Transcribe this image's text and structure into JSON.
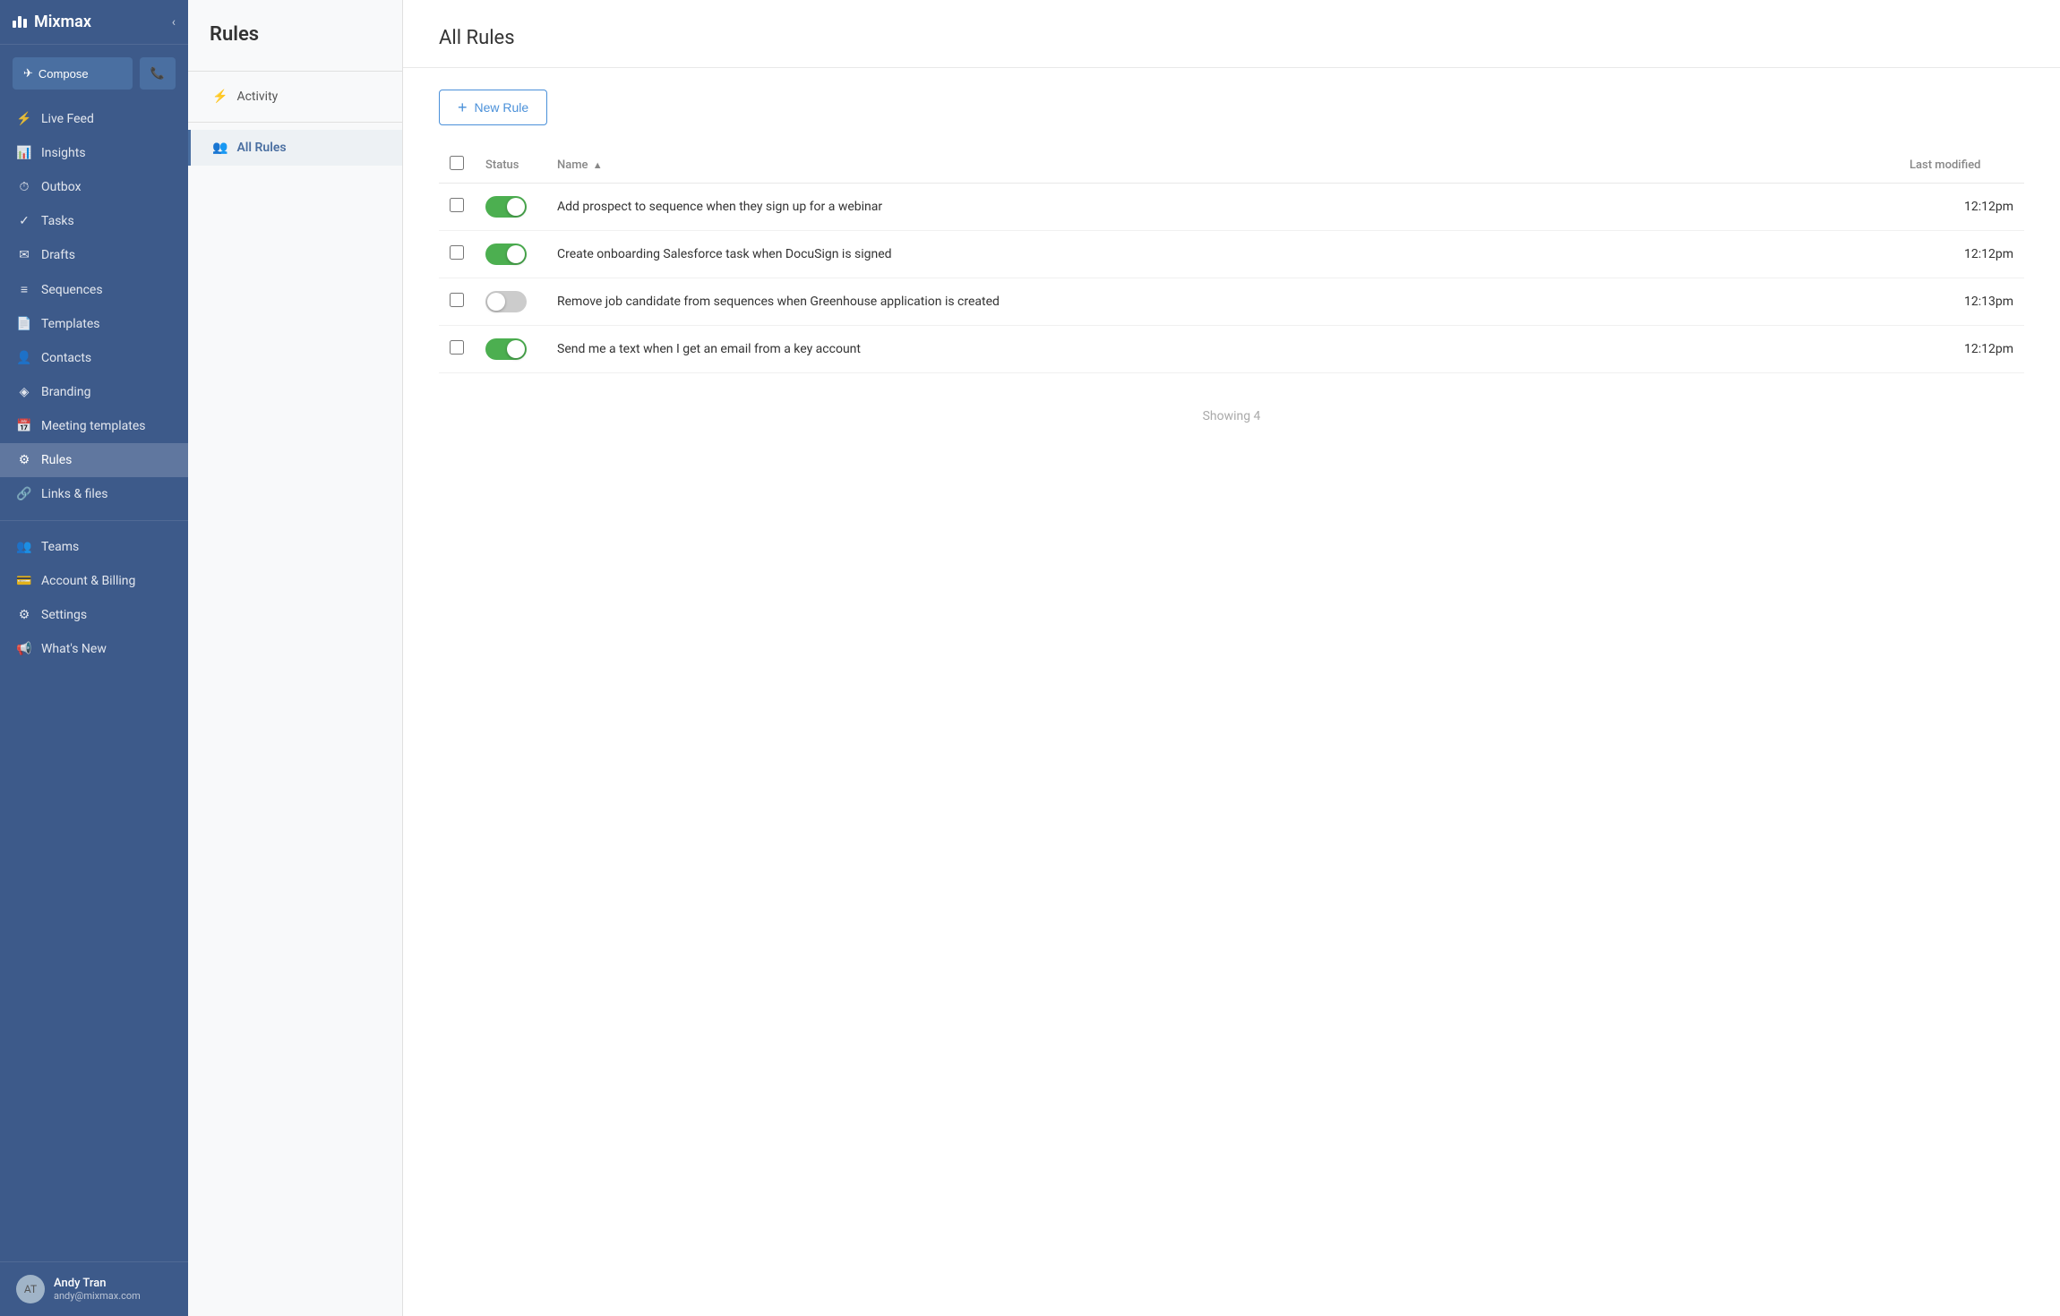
{
  "app": {
    "name": "Mixmax"
  },
  "sidebar": {
    "collapse_label": "‹",
    "compose_label": "Compose",
    "phone_label": "☎",
    "nav_items": [
      {
        "id": "live-feed",
        "label": "Live Feed",
        "icon": "⚡",
        "active": false
      },
      {
        "id": "insights",
        "label": "Insights",
        "icon": "📊",
        "active": false
      },
      {
        "id": "outbox",
        "label": "Outbox",
        "icon": "⏱",
        "active": false
      },
      {
        "id": "tasks",
        "label": "Tasks",
        "icon": "✓",
        "active": false
      },
      {
        "id": "drafts",
        "label": "Drafts",
        "icon": "✉",
        "active": false
      },
      {
        "id": "sequences",
        "label": "Sequences",
        "icon": "≡",
        "active": false
      },
      {
        "id": "templates",
        "label": "Templates",
        "icon": "📄",
        "active": false
      },
      {
        "id": "contacts",
        "label": "Contacts",
        "icon": "👤",
        "active": false
      },
      {
        "id": "branding",
        "label": "Branding",
        "icon": "◈",
        "active": false
      },
      {
        "id": "meeting-templates",
        "label": "Meeting templates",
        "icon": "📅",
        "active": false
      },
      {
        "id": "rules",
        "label": "Rules",
        "icon": "⚙",
        "active": true
      },
      {
        "id": "links-files",
        "label": "Links & files",
        "icon": "🔗",
        "active": false
      },
      {
        "id": "teams",
        "label": "Teams",
        "icon": "👥",
        "active": false
      },
      {
        "id": "account-billing",
        "label": "Account & Billing",
        "icon": "💳",
        "active": false
      },
      {
        "id": "settings",
        "label": "Settings",
        "icon": "⚙",
        "active": false
      },
      {
        "id": "whats-new",
        "label": "What's New",
        "icon": "📢",
        "active": false
      }
    ],
    "user": {
      "name": "Andy Tran",
      "email": "andy@mixmax.com"
    }
  },
  "middle_panel": {
    "title": "Rules",
    "nav_items": [
      {
        "id": "activity",
        "label": "Activity",
        "icon": "⚡",
        "active": false
      },
      {
        "id": "all-rules",
        "label": "All Rules",
        "icon": "👥",
        "active": true
      }
    ]
  },
  "main": {
    "title": "All Rules",
    "new_rule_label": "New Rule",
    "table": {
      "columns": {
        "status": "Status",
        "name": "Name",
        "sort_arrow": "▲",
        "last_modified": "Last modified"
      },
      "rows": [
        {
          "id": 1,
          "status_on": true,
          "name": "Add prospect to sequence when they sign up for a webinar",
          "last_modified": "12:12pm"
        },
        {
          "id": 2,
          "status_on": true,
          "name": "Create onboarding Salesforce task when DocuSign is signed",
          "last_modified": "12:12pm"
        },
        {
          "id": 3,
          "status_on": false,
          "name": "Remove job candidate from sequences when Greenhouse application is created",
          "last_modified": "12:13pm"
        },
        {
          "id": 4,
          "status_on": true,
          "name": "Send me a text when I get an email from a key account",
          "last_modified": "12:12pm"
        }
      ]
    },
    "showing_text": "Showing 4"
  }
}
